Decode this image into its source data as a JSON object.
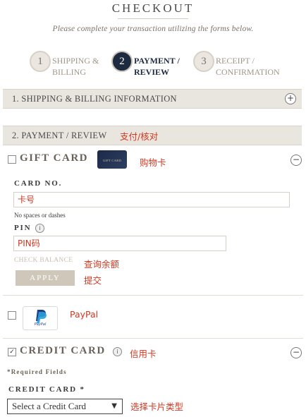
{
  "header": {
    "title": "CHECKOUT",
    "subtitle": "Please complete your transaction utilizing the forms below."
  },
  "steps": [
    {
      "number": "1",
      "label_line1": "SHIPPING &",
      "label_line2": "BILLING",
      "active": false
    },
    {
      "number": "2",
      "label_line1": "PAYMENT /",
      "label_line2": "REVIEW",
      "active": true
    },
    {
      "number": "3",
      "label_line1": "RECEIPT /",
      "label_line2": "CONFIRMATION",
      "active": false
    }
  ],
  "sections": {
    "shipping": {
      "label": "1. SHIPPING & BILLING INFORMATION",
      "toggle": "+"
    },
    "payment": {
      "label": "2. PAYMENT / REVIEW",
      "annotation": "支付/核对"
    }
  },
  "gift_card": {
    "heading": "GIFT CARD",
    "card_image_text": "GIFT CARD",
    "annotation": "购物卡",
    "toggle": "−",
    "card_no_label": "CARD NO.",
    "card_no_value": "卡号",
    "card_no_hint": "No spaces or dashes",
    "pin_label": "PIN",
    "pin_info": "i",
    "pin_value": "PIN码",
    "check_balance": "CHECK BALANCE",
    "check_balance_annotation": "查询余额",
    "apply_label": "APPLY",
    "apply_annotation": "提交"
  },
  "paypal": {
    "label": "PayPal",
    "logo_text": "PayPal"
  },
  "credit_card": {
    "heading": "CREDIT CARD",
    "info": "i",
    "annotation": "信用卡",
    "toggle": "−",
    "checked": true,
    "required_note": "*Required Fields",
    "field_label": "CREDIT CARD *",
    "select_value": "Select a Credit Card",
    "select_annotation": "选择卡片类型"
  },
  "colors": {
    "annotation_red": "#d2371f",
    "active_step_navy": "#1d2a40",
    "bar_background": "#e9e6e0"
  }
}
